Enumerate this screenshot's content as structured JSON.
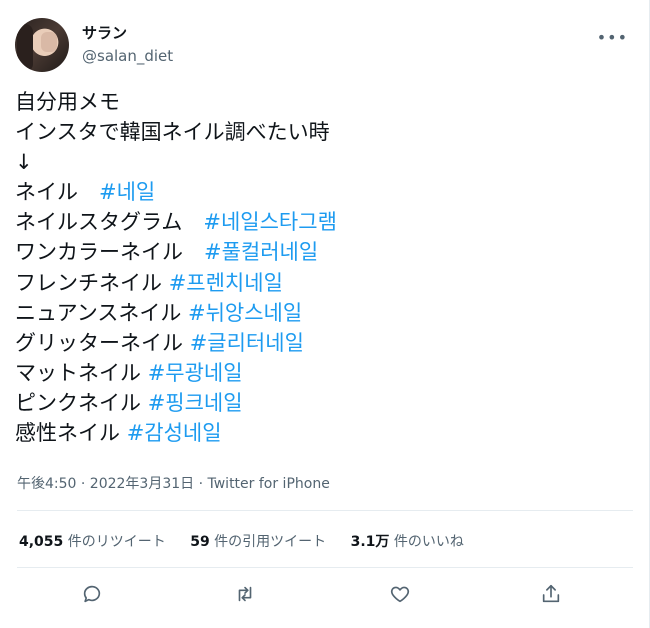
{
  "user": {
    "display_name": "サラン",
    "handle": "@salan_diet"
  },
  "tweet": {
    "lines": [
      {
        "text": "自分用メモ",
        "tag": ""
      },
      {
        "text": "インスタで韓国ネイル調べたい時",
        "tag": ""
      },
      {
        "text": "↓",
        "tag": ""
      },
      {
        "text": "ネイル　",
        "tag": "#네일"
      },
      {
        "text": "ネイルスタグラム　",
        "tag": "#네일스타그램"
      },
      {
        "text": "ワンカラーネイル　",
        "tag": "#풀컬러네일"
      },
      {
        "text": "フレンチネイル ",
        "tag": "#프렌치네일"
      },
      {
        "text": "ニュアンスネイル ",
        "tag": "#뉘앙스네일"
      },
      {
        "text": "グリッターネイル ",
        "tag": "#글리터네일"
      },
      {
        "text": "マットネイル ",
        "tag": "#무광네일"
      },
      {
        "text": "ピンクネイル ",
        "tag": "#핑크네일"
      },
      {
        "text": "感性ネイル ",
        "tag": "#감성네일"
      }
    ],
    "timestamp": "午後4:50 · 2022年3月31日 · Twitter for iPhone"
  },
  "stats": {
    "retweets_count": "4,055",
    "retweets_label": "件のリツイート",
    "quotes_count": "59",
    "quotes_label": "件の引用ツイート",
    "likes_count": "3.1万",
    "likes_label": "件のいいね"
  },
  "actions": [
    "reply-icon",
    "retweet-icon",
    "like-icon",
    "share-icon"
  ],
  "colors": {
    "hashtag": "#1d9bf0",
    "secondary_text": "#536471",
    "divider": "#e6ecf0"
  }
}
